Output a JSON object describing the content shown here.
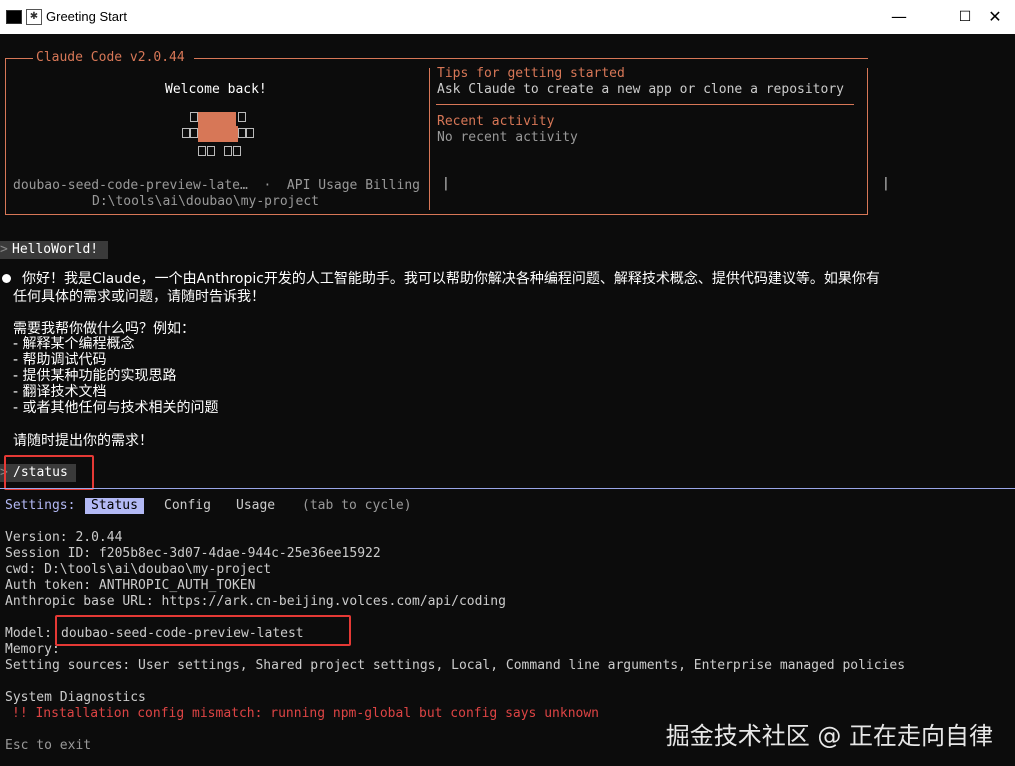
{
  "window": {
    "title": "Greeting Start",
    "minimize": "—",
    "maximize": "☐",
    "close": "✕"
  },
  "welcome_box": {
    "header": "Claude Code v2.0.44",
    "welcome": "Welcome back!",
    "model_line": "doubao-seed-code-preview-late…  ·  API Usage Billing",
    "path": "D:\\tools\\ai\\doubao\\my-project",
    "tips_title": "Tips for getting started",
    "tips_text": "Ask Claude to create a new app or clone a repository",
    "recent_title": "Recent activity",
    "recent_text": "No recent activity",
    "accent_color": "#d77757"
  },
  "conversation": {
    "user_prompt": "HelloWorld!",
    "reply_line1": "你好！我是Claude，一个由Anthropic开发的人工智能助手。我可以帮助你解决各种编程问题、解释技术概念、提供代码建议等。如果你有",
    "reply_line2": "任何具体的需求或问题，请随时告诉我！",
    "ask_line": "需要我帮你做什么吗？例如：",
    "bullets": [
      "- 解释某个编程概念",
      "- 帮助调试代码",
      "- 提供某种功能的实现思路",
      "- 翻译技术文档",
      "- 或者其他任何与技术相关的问题"
    ],
    "closing": "请随时提出你的需求！",
    "command": "/status",
    "prompt_marker": ">"
  },
  "settings": {
    "label": "Settings:",
    "tabs": [
      "Status",
      "Config",
      "Usage"
    ],
    "active_tab": "Status",
    "hint": "(tab to cycle)",
    "version": "Version: 2.0.44",
    "session": "Session ID: f205b8ec-3d07-4dae-944c-25e36ee15922",
    "cwd": "cwd: D:\\tools\\ai\\doubao\\my-project",
    "auth": "Auth token: ANTHROPIC_AUTH_TOKEN",
    "base_url": "Anthropic base URL: https://ark.cn-beijing.volces.com/api/coding",
    "model_label": "Model:",
    "model_value": "doubao-seed-code-preview-latest",
    "memory": "Memory:",
    "sources": "Setting sources: User settings, Shared project settings, Local, Command line arguments, Enterprise managed policies",
    "diag_title": "System Diagnostics",
    "diag_warning": "!! Installation config mismatch: running npm-global but config says unknown",
    "exit_hint": "Esc to exit"
  },
  "watermark": "掘金技术社区 @ 正在走向自律"
}
